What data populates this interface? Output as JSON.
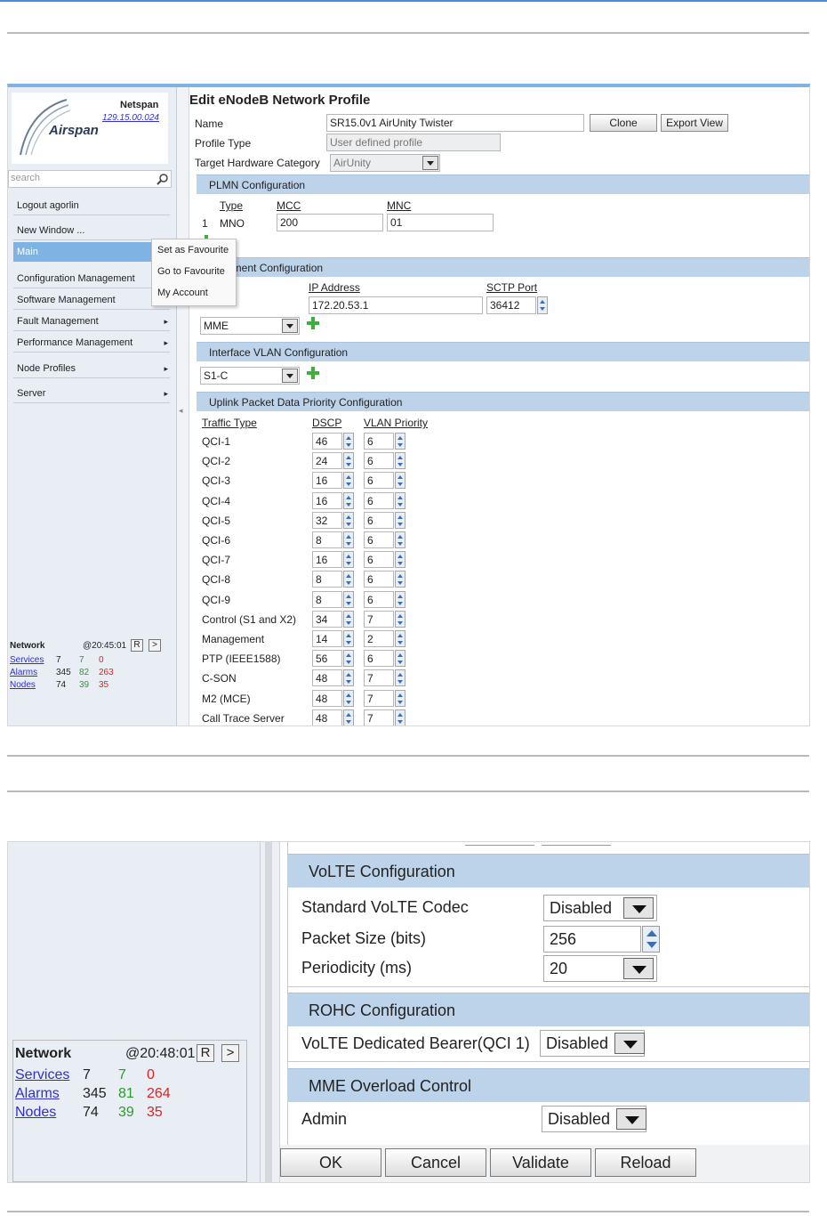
{
  "brand": {
    "vendor": "Netspan",
    "version": "129.15.00.024",
    "logo": "Airspan"
  },
  "sidebar": {
    "search_placeholder": "search",
    "items": [
      {
        "label": "Logout agorlin",
        "arrow": ""
      },
      {
        "label": "New Window ...",
        "arrow": ""
      },
      {
        "label": "Main",
        "arrow": ""
      },
      {
        "label": "Configuration Management",
        "arrow": ""
      },
      {
        "label": "Software Management",
        "arrow": ""
      },
      {
        "label": "Fault Management",
        "arrow": "▸"
      },
      {
        "label": "Performance Management",
        "arrow": "▸"
      },
      {
        "label": "Node Profiles",
        "arrow": "▸"
      },
      {
        "label": "Server",
        "arrow": "▸"
      }
    ]
  },
  "context_menu": [
    "Set as Favourite",
    "Go to Favourite",
    "My Account"
  ],
  "network1": {
    "title": "Network",
    "time": "@20:45:01",
    "r_label": "R",
    "next_label": ">",
    "rows": [
      {
        "name": "Services",
        "a": "7",
        "b": "7",
        "c": "0"
      },
      {
        "name": "Alarms",
        "a": "345",
        "b": "82",
        "c": "263"
      },
      {
        "name": "Nodes",
        "a": "74",
        "b": "39",
        "c": "35"
      }
    ]
  },
  "profile": {
    "title": "Edit eNodeB Network Profile",
    "name_label": "Name",
    "name_value": "SR15.0v1 AirUnity Twister",
    "clone_label": "Clone",
    "export_label": "Export View",
    "type_label": "Profile Type",
    "type_value": "User defined profile",
    "hw_label": "Target Hardware Category",
    "hw_value": "AirUnity",
    "plmn": {
      "header": "PLMN Configuration",
      "col_type": "Type",
      "col_mcc": "MCC",
      "col_mnc": "MNC",
      "row_index": "1",
      "row_type": "MNO",
      "mcc": "200",
      "mnc": "01"
    },
    "element": {
      "header": "k Element Configuration",
      "col_ip": "IP Address",
      "col_port": "SCTP Port",
      "ip": "172.20.53.1",
      "port": "36412",
      "type": "MME"
    },
    "vlan": {
      "header": "Interface VLAN Configuration",
      "value": "S1-C"
    },
    "uplink": {
      "header": "Uplink Packet Data Priority Configuration",
      "col_traffic": "Traffic Type",
      "col_dscp": "DSCP",
      "col_vlan": "VLAN Priority",
      "rows": [
        {
          "t": "QCI-1",
          "d": "46",
          "v": "6"
        },
        {
          "t": "QCI-2",
          "d": "24",
          "v": "6"
        },
        {
          "t": "QCI-3",
          "d": "16",
          "v": "6"
        },
        {
          "t": "QCI-4",
          "d": "16",
          "v": "6"
        },
        {
          "t": "QCI-5",
          "d": "32",
          "v": "6"
        },
        {
          "t": "QCI-6",
          "d": "8",
          "v": "6"
        },
        {
          "t": "QCI-7",
          "d": "16",
          "v": "6"
        },
        {
          "t": "QCI-8",
          "d": "8",
          "v": "6"
        },
        {
          "t": "QCI-9",
          "d": "8",
          "v": "6"
        },
        {
          "t": "Control (S1 and X2)",
          "d": "34",
          "v": "7"
        },
        {
          "t": "Management",
          "d": "14",
          "v": "2"
        },
        {
          "t": "PTP (IEEE1588)",
          "d": "56",
          "v": "6"
        },
        {
          "t": "C-SON",
          "d": "48",
          "v": "7"
        },
        {
          "t": "M2 (MCE)",
          "d": "48",
          "v": "7"
        },
        {
          "t": "Call Trace Server",
          "d": "48",
          "v": "7"
        }
      ]
    }
  },
  "network2": {
    "title": "Network",
    "time": "@20:48:01",
    "r_label": "R",
    "next_label": ">",
    "rows": [
      {
        "name": "Services",
        "a": "7",
        "b": "7",
        "c": "0"
      },
      {
        "name": "Alarms",
        "a": "345",
        "b": "81",
        "c": "264"
      },
      {
        "name": "Nodes",
        "a": "74",
        "b": "39",
        "c": "35"
      }
    ]
  },
  "volte": {
    "header": "VoLTE Configuration",
    "codec_label": "Standard VoLTE Codec",
    "codec_value": "Disabled",
    "packet_label": "Packet Size (bits)",
    "packet_value": "256",
    "period_label": "Periodicity (ms)",
    "period_value": "20"
  },
  "rohc": {
    "header": "ROHC Configuration",
    "bearer_label": "VoLTE Dedicated Bearer(QCI 1)",
    "bearer_value": "Disabled"
  },
  "mme": {
    "header": "MME Overload Control",
    "admin_label": "Admin",
    "admin_value": "Disabled"
  },
  "actions": {
    "ok": "OK",
    "cancel": "Cancel",
    "validate": "Validate",
    "reload": "Reload"
  },
  "colors": {
    "accent": "#4a8cd8",
    "section": "#bcd3ea",
    "selected": "#7fb3e3",
    "green": "#2a9a2a",
    "red": "#e02020"
  }
}
